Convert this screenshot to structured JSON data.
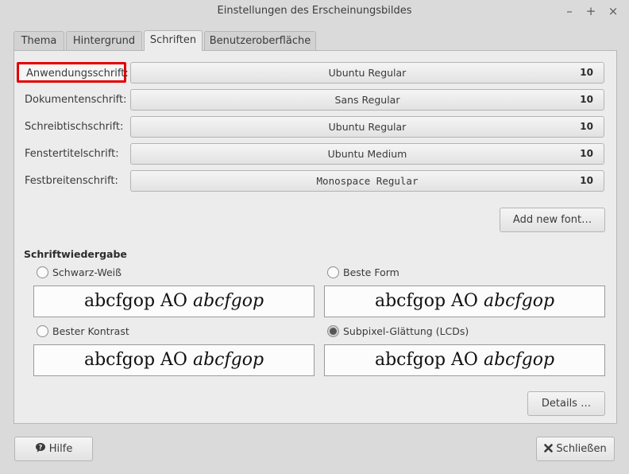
{
  "window": {
    "title": "Einstellungen des Erscheinungsbildes",
    "controls": {
      "minimize": "–",
      "maximize": "+",
      "close": "×"
    }
  },
  "tabs": [
    {
      "label": "Thema"
    },
    {
      "label": "Hintergrund"
    },
    {
      "label": "Schriften",
      "active": true
    },
    {
      "label": "Benutzeroberfläche"
    }
  ],
  "fonts": [
    {
      "label": "Anwendungsschrift:",
      "font": "Ubuntu Regular",
      "size": "10"
    },
    {
      "label": "Dokumentenschrift:",
      "font": "Sans Regular",
      "size": "10"
    },
    {
      "label": "Schreibtischschrift:",
      "font": "Ubuntu Regular",
      "size": "10"
    },
    {
      "label": "Fenstertitelschrift:",
      "font": "Ubuntu Medium",
      "size": "10"
    },
    {
      "label": "Festbreitenschrift:",
      "font": "Monospace Regular",
      "size": "10"
    }
  ],
  "add_font_label": "Add new font…",
  "rendering": {
    "title": "Schriftwiedergabe",
    "options": [
      {
        "label": "Schwarz-Weiß",
        "selected": false
      },
      {
        "label": "Beste Form",
        "selected": false
      },
      {
        "label": "Bester Kontrast",
        "selected": false
      },
      {
        "label": "Subpixel-Glättung (LCDs)",
        "selected": true
      }
    ],
    "sample_regular": "abcfgop AO ",
    "sample_italic": "abcfgop"
  },
  "details_label": "Details …",
  "help": {
    "label": "Hilfe",
    "icon": "help-icon"
  },
  "close": {
    "label": "Schließen",
    "icon": "close-icon"
  },
  "colors": {
    "highlight_border": "#e30000"
  }
}
